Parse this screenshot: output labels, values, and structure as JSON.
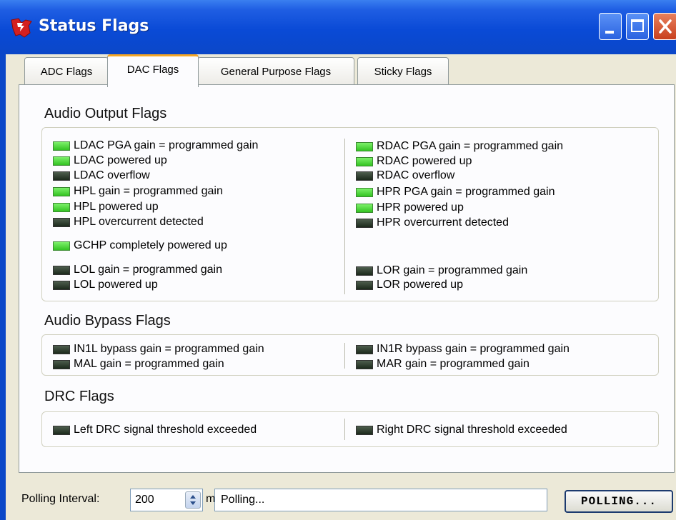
{
  "window": {
    "title": "Status Flags",
    "buttons": [
      "minimize",
      "maximize",
      "close"
    ]
  },
  "tabs": [
    {
      "label": "ADC Flags",
      "active": false
    },
    {
      "label": "DAC Flags",
      "active": true
    },
    {
      "label": "General Purpose Flags",
      "active": false
    },
    {
      "label": "Sticky Flags",
      "active": false
    }
  ],
  "sections": {
    "audio_output": {
      "title": "Audio Output Flags",
      "left": [
        {
          "label": "LDAC PGA gain = programmed gain",
          "on": true
        },
        {
          "label": "LDAC powered up",
          "on": true
        },
        {
          "label": "LDAC overflow",
          "on": false
        },
        {
          "label": "HPL gain = programmed gain",
          "on": true
        },
        {
          "label": "HPL powered up",
          "on": true
        },
        {
          "label": "HPL overcurrent detected",
          "on": false
        },
        {
          "label": "GCHP completely powered up",
          "on": true
        },
        {
          "label": "LOL gain = programmed gain",
          "on": false
        },
        {
          "label": "LOL powered up",
          "on": false
        }
      ],
      "right": [
        {
          "label": "RDAC PGA gain = programmed gain",
          "on": true
        },
        {
          "label": "RDAC powered up",
          "on": true
        },
        {
          "label": "RDAC overflow",
          "on": false
        },
        {
          "label": "HPR PGA gain = programmed gain",
          "on": true
        },
        {
          "label": "HPR powered up",
          "on": true
        },
        {
          "label": "HPR overcurrent detected",
          "on": false
        },
        {
          "label": "LOR gain = programmed gain",
          "on": false
        },
        {
          "label": "LOR powered up",
          "on": false
        }
      ]
    },
    "audio_bypass": {
      "title": "Audio Bypass Flags",
      "left": [
        {
          "label": "IN1L bypass gain = programmed gain",
          "on": false
        },
        {
          "label": "MAL gain = programmed gain",
          "on": false
        }
      ],
      "right": [
        {
          "label": "IN1R bypass gain = programmed gain",
          "on": false
        },
        {
          "label": "MAR gain = programmed gain",
          "on": false
        }
      ]
    },
    "drc": {
      "title": "DRC Flags",
      "left": [
        {
          "label": "Left DRC signal threshold exceeded",
          "on": false
        }
      ],
      "right": [
        {
          "label": "Right DRC signal threshold exceeded",
          "on": false
        }
      ]
    }
  },
  "footer": {
    "polling_label": "Polling Interval:",
    "interval_value": "200",
    "unit": "ms",
    "status_text": "Polling...",
    "poll_button": "POLLING..."
  },
  "colors": {
    "led_on": "#33c322",
    "led_off": "#1c2a1c",
    "titlebar": "#0a4ad6",
    "active_tab_accent": "#f5a625"
  }
}
